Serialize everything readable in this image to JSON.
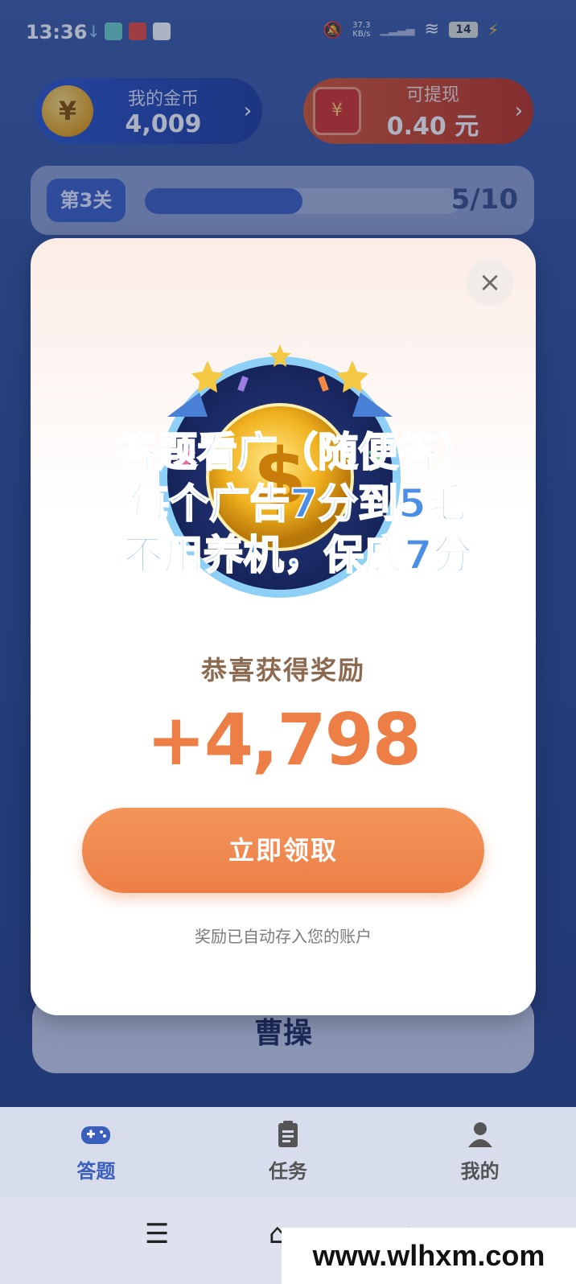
{
  "status_bar": {
    "time": "13:36",
    "net_speed_value": "37.3",
    "net_speed_unit": "KB/s",
    "battery": "14",
    "icons": [
      "download-icon",
      "app-icon",
      "app-red-icon",
      "mail-icon",
      "mute-icon",
      "signal-icon",
      "wifi-icon",
      "battery-icon",
      "charging-icon"
    ]
  },
  "header": {
    "coins_label": "我的金币",
    "coins_value": "4,009",
    "coins_chevron": "›",
    "coin_symbol": "¥",
    "cash_label": "可提现",
    "cash_value": "0.40 元",
    "cash_chevron": "›",
    "envelope_symbol": "¥"
  },
  "level": {
    "badge": "第3关",
    "progress_text": "5/10",
    "progress_fraction": 0.5
  },
  "answer_option": "曹操",
  "modal": {
    "close_symbol": "×",
    "title": "恭喜获得奖励",
    "amount": "+4,798",
    "claim_button": "立即领取",
    "footnote": "奖励已自动存入您的账户"
  },
  "caption_overlay": {
    "line1": "答题看广（随便答）",
    "line2": "每个广告7分到5毛",
    "line3": "不用养机，保底7分"
  },
  "tabs": [
    {
      "label": "答题",
      "icon": "gamepad-icon",
      "active": true
    },
    {
      "label": "任务",
      "icon": "clipboard-icon",
      "active": false
    },
    {
      "label": "我的",
      "icon": "user-icon",
      "active": false
    }
  ],
  "nav": {
    "menu_symbol": "☰",
    "home_symbol": "⌂",
    "back_symbol": "↩"
  },
  "watermark": "www.wlhxm.com",
  "colors": {
    "accent_orange": "#ec7f46",
    "active_tab": "#3b5fbd",
    "caption_blue": "#4a8fe3"
  }
}
